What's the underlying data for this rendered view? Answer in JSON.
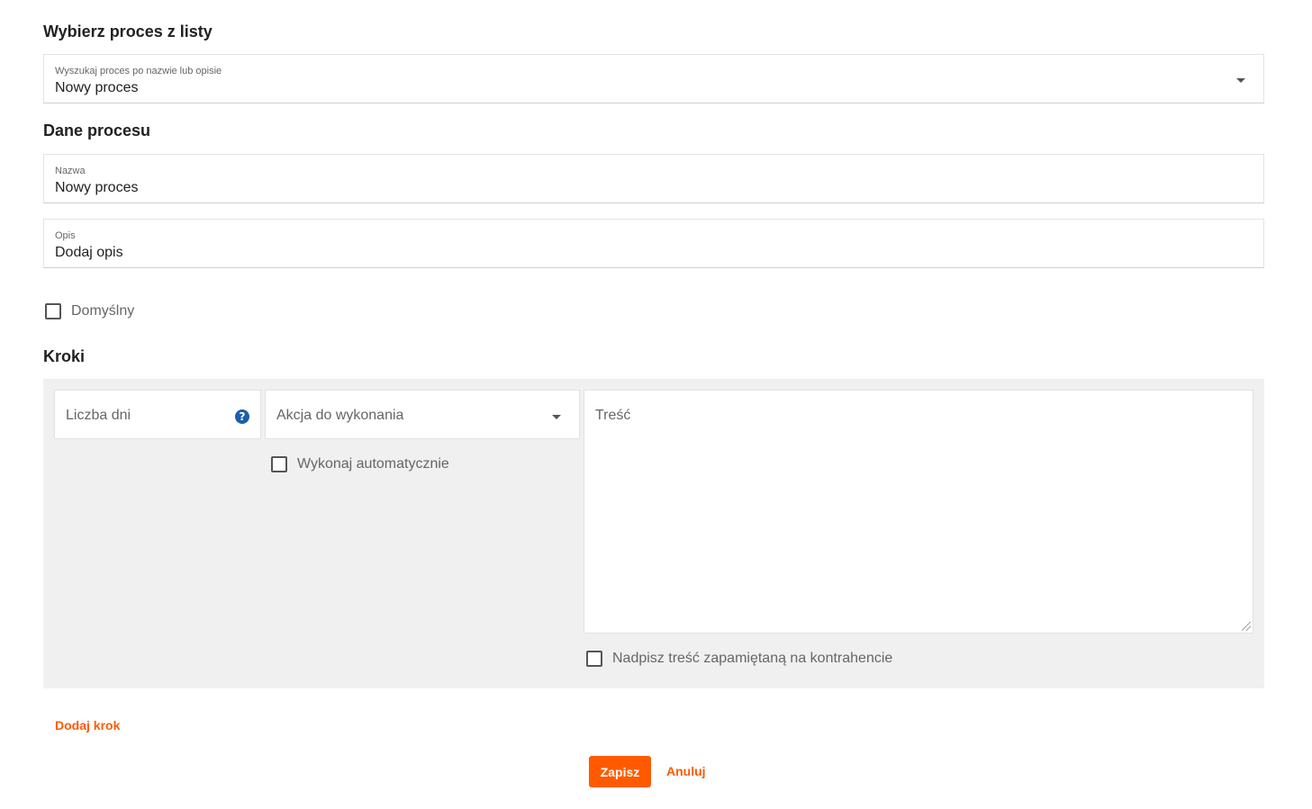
{
  "select_process": {
    "title": "Wybierz proces z listy",
    "search_label": "Wyszukaj proces po nazwie lub opisie",
    "search_value": "Nowy proces"
  },
  "process_data": {
    "title": "Dane procesu",
    "name_label": "Nazwa",
    "name_value": "Nowy proces",
    "description_label": "Opis",
    "description_value": "Dodaj opis",
    "default_checkbox_label": "Domyślny"
  },
  "steps": {
    "title": "Kroki",
    "days_placeholder": "Liczba dni",
    "action_placeholder": "Akcja do wykonania",
    "content_placeholder": "Treść",
    "auto_checkbox_label": "Wykonaj automatycznie",
    "override_checkbox_label": "Nadpisz treść zapamiętaną na kontrahencie",
    "add_step_label": "Dodaj krok"
  },
  "actions": {
    "save_label": "Zapisz",
    "cancel_label": "Anuluj"
  },
  "colors": {
    "accent": "#ff5a00",
    "help_icon": "#1a5fa8",
    "panel_bg": "#f0f0f0"
  },
  "icons": {
    "dropdown": "chevron-down-icon",
    "help": "question-circle-icon",
    "resize": "resize-grip-icon"
  }
}
